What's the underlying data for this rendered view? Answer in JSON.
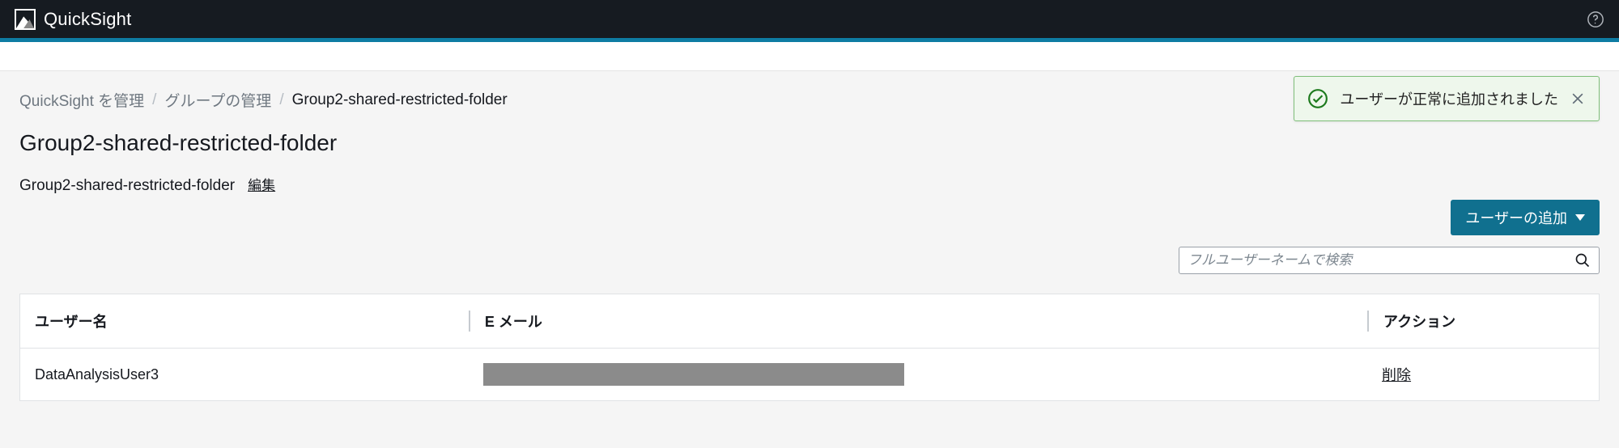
{
  "app": {
    "title": "QuickSight"
  },
  "breadcrumb": {
    "items": [
      {
        "label": "QuickSight を管理"
      },
      {
        "label": "グループの管理"
      },
      {
        "label": "Group2-shared-restricted-folder"
      }
    ]
  },
  "page": {
    "title": "Group2-shared-restricted-folder",
    "name": "Group2-shared-restricted-folder",
    "edit_label": "編集"
  },
  "toast": {
    "message": "ユーザーが正常に追加されました"
  },
  "actions": {
    "add_user_label": "ユーザーの追加"
  },
  "search": {
    "placeholder": "フルユーザーネームで検索"
  },
  "table": {
    "headers": {
      "user": "ユーザー名",
      "email": "E メール",
      "action": "アクション"
    },
    "rows": [
      {
        "user": "DataAnalysisUser3",
        "email": "",
        "action_label": "削除"
      }
    ]
  }
}
